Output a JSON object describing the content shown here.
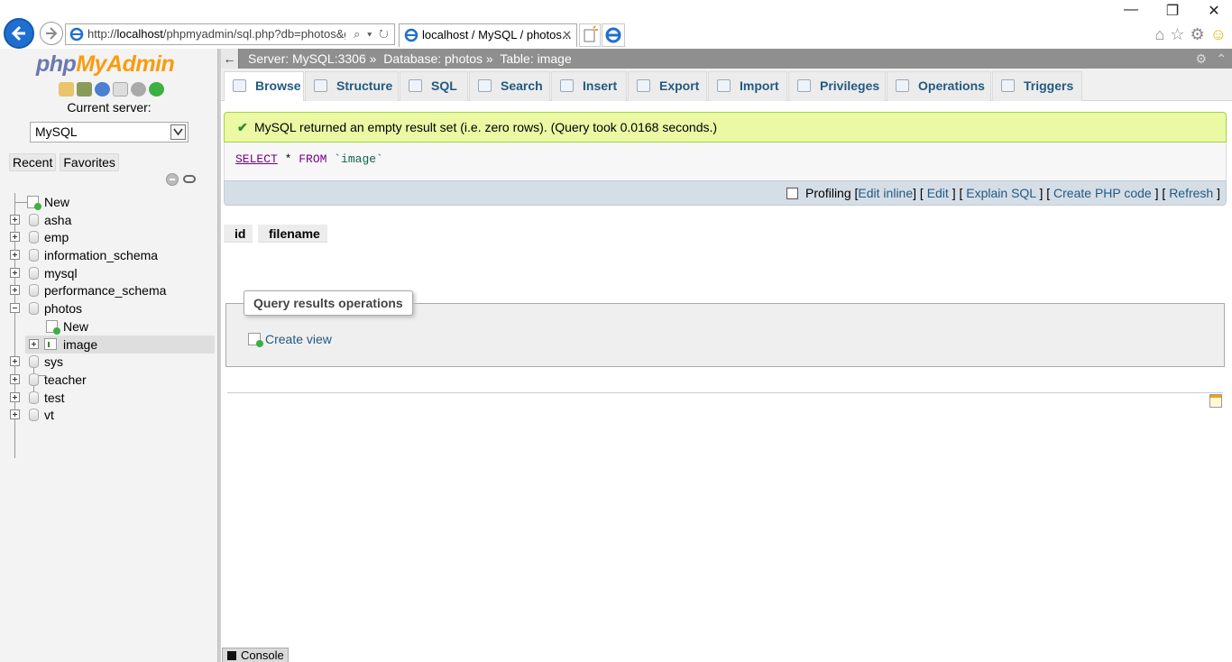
{
  "browser": {
    "url_prefix": "http://",
    "url_host": "localhost",
    "url_rest": "/phpmyadmin/sql.php?db=photos&g",
    "url_tools": "⌕ ▾ ↻",
    "tab_title": "localhost / MySQL / photos...",
    "tab_close": "✕",
    "win_min": "—",
    "win_max": "❐",
    "win_close": "✕",
    "icons": [
      "home-icon",
      "star-icon",
      "gear-icon",
      "smiley-icon"
    ]
  },
  "nav": {
    "logo_php": "php",
    "logo_myadmin": "MyAdmin",
    "current_server_label": "Current server:",
    "server_value": "MySQL",
    "recent_label": "Recent",
    "favorites_label": "Favorites",
    "tree": [
      {
        "label": "New"
      },
      {
        "label": "asha"
      },
      {
        "label": "emp"
      },
      {
        "label": "information_schema"
      },
      {
        "label": "mysql"
      },
      {
        "label": "performance_schema"
      },
      {
        "label": "photos"
      },
      {
        "label": "New"
      },
      {
        "label": "image"
      },
      {
        "label": "sys"
      },
      {
        "label": "teacher"
      },
      {
        "label": "test"
      },
      {
        "label": "vt"
      }
    ]
  },
  "breadcrumb": {
    "back_arrow": "←",
    "server": "Server: MySQL:3306 »",
    "database": "Database: photos »",
    "table": "Table: image",
    "gear": "⚙",
    "collapse": "⌃"
  },
  "tabs": [
    {
      "label": "Browse"
    },
    {
      "label": "Structure"
    },
    {
      "label": "SQL"
    },
    {
      "label": "Search"
    },
    {
      "label": "Insert"
    },
    {
      "label": "Export"
    },
    {
      "label": "Import"
    },
    {
      "label": "Privileges"
    },
    {
      "label": "Operations"
    },
    {
      "label": "Triggers"
    }
  ],
  "result": {
    "check": "✔",
    "message": "MySQL returned an empty result set (i.e. zero rows). (Query took 0.0168 seconds.)",
    "sql_select": "SELECT",
    "sql_star": " * ",
    "sql_from": "FROM",
    "sql_table": " `image`"
  },
  "sqltools": {
    "profiling": "Profiling",
    "edit_inline": "Edit inline",
    "edit": "Edit",
    "explain": "Explain SQL",
    "create_php": "Create PHP code",
    "refresh": "Refresh"
  },
  "columns": [
    "id",
    "filename"
  ],
  "operations": {
    "legend": "Query results operations",
    "create_view": "Create view"
  },
  "console": {
    "label": "Console"
  }
}
